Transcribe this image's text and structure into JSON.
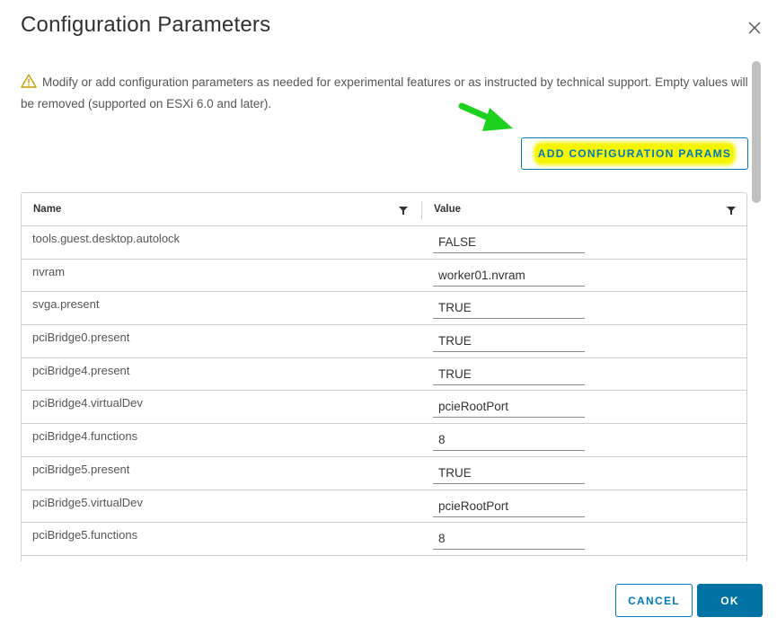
{
  "dialog": {
    "title": "Configuration Parameters",
    "close_icon": "close-icon"
  },
  "info": {
    "icon": "warning-icon",
    "text": "Modify or add configuration parameters as needed for experimental features or as instructed by technical support. Empty values will be removed (supported on ESXi 6.0 and later)."
  },
  "annotation": {
    "arrow_icon": "arrow-icon",
    "arrow_color": "#1fd11f",
    "highlight_color": "#f5f500"
  },
  "toolbar": {
    "add_label": "ADD CONFIGURATION PARAMS"
  },
  "grid": {
    "columns": [
      {
        "label": "Name",
        "filter_icon": "filter-icon"
      },
      {
        "label": "Value",
        "filter_icon": "filter-icon"
      }
    ],
    "rows": [
      {
        "name": "tools.guest.desktop.autolock",
        "value": "FALSE"
      },
      {
        "name": "nvram",
        "value": "worker01.nvram"
      },
      {
        "name": "svga.present",
        "value": "TRUE"
      },
      {
        "name": "pciBridge0.present",
        "value": "TRUE"
      },
      {
        "name": "pciBridge4.present",
        "value": "TRUE"
      },
      {
        "name": "pciBridge4.virtualDev",
        "value": "pcieRootPort"
      },
      {
        "name": "pciBridge4.functions",
        "value": "8"
      },
      {
        "name": "pciBridge5.present",
        "value": "TRUE"
      },
      {
        "name": "pciBridge5.virtualDev",
        "value": "pcieRootPort"
      },
      {
        "name": "pciBridge5.functions",
        "value": "8"
      }
    ]
  },
  "footer": {
    "cancel_label": "CANCEL",
    "ok_label": "OK"
  },
  "colors": {
    "primary": "#0079b8",
    "primary_solid": "#0072a3",
    "warning": "#c89b00",
    "border": "#d0d0d0"
  }
}
